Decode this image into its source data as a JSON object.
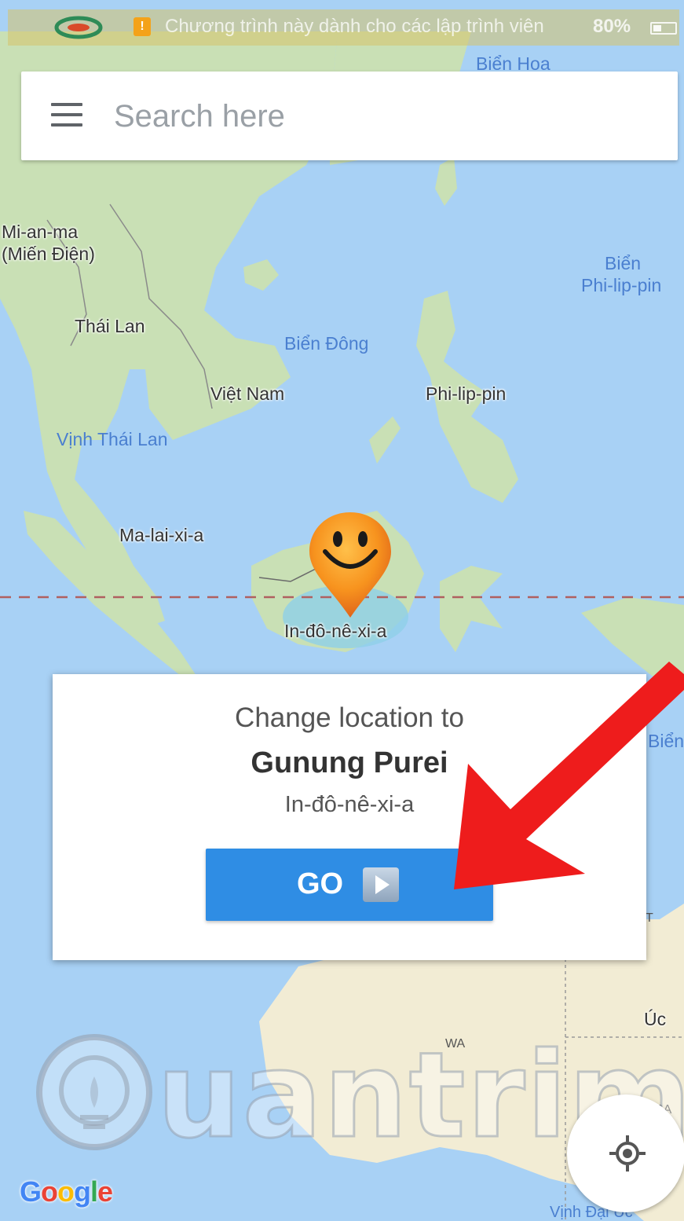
{
  "status_bar": {
    "notification_text": "Chương trình này dành cho các lập trình viên",
    "battery": "80%"
  },
  "search": {
    "placeholder": "Search here"
  },
  "map": {
    "labels": {
      "bien_hoa": "Biển Hoa",
      "mianma": "Mi-an-ma",
      "mianma_sub": "(Miến Điện)",
      "thai_lan": "Thái Lan",
      "bien_dong": "Biển Đông",
      "viet_nam": "Việt Nam",
      "vinh_thai_lan": "Vịnh Thái Lan",
      "philippines": "Phi-lip-pin",
      "bien_philippines_1": "Biển",
      "bien_philippines_2": "Phi-lip-pin",
      "malaysia": "Ma-lai-xi-a",
      "indonesia": "In-đô-nê-xi-a",
      "bien_a": "Biển A",
      "uc": "Úc",
      "wa": "WA",
      "sa": "SA",
      "vinh_dai_uc": "Vịnh Đại Úc",
      "nt": "T"
    }
  },
  "location_dialog": {
    "prompt": "Change location to",
    "place_name": "Gunung Purei",
    "country": "In-đô-nê-xi-a",
    "go_label": "GO"
  },
  "watermark": {
    "text": "uantrimang"
  },
  "google_logo": {
    "letters": [
      "G",
      "o",
      "o",
      "g",
      "l",
      "e"
    ]
  },
  "colors": {
    "water": "#a8d1f5",
    "land": "#c9e0b5",
    "land_dry": "#f2ecd4",
    "go_button": "#2f8de4",
    "arrow": "#ee1c1c",
    "marker": "#f7931e",
    "equator": "#b06060"
  },
  "icons": {
    "menu": "hamburger-menu-icon",
    "marker": "smiley-location-marker-icon",
    "play": "play-icon",
    "my_location": "gps-target-icon"
  }
}
